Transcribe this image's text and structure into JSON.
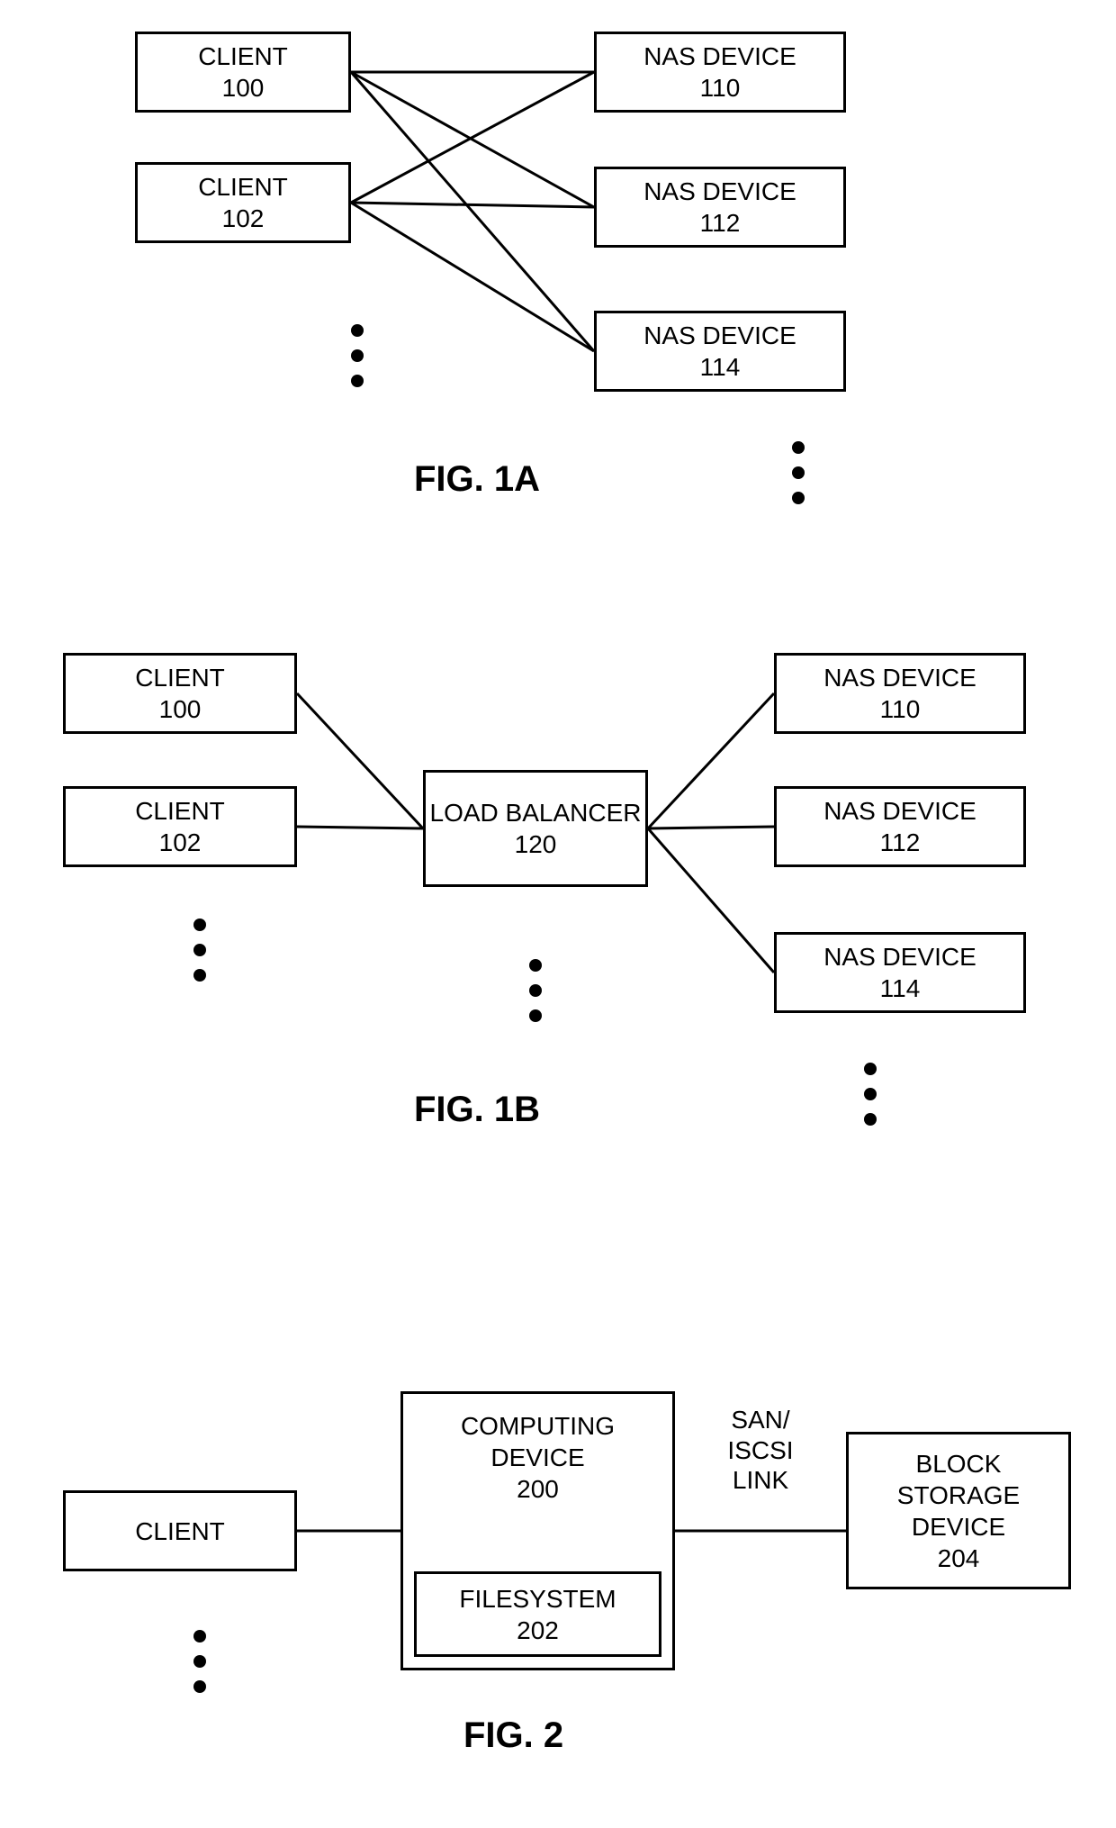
{
  "fig1a": {
    "clients": [
      {
        "name": "CLIENT",
        "id": "100"
      },
      {
        "name": "CLIENT",
        "id": "102"
      }
    ],
    "nas": [
      {
        "name": "NAS DEVICE",
        "id": "110"
      },
      {
        "name": "NAS DEVICE",
        "id": "112"
      },
      {
        "name": "NAS DEVICE",
        "id": "114"
      }
    ],
    "label": "FIG. 1A"
  },
  "fig1b": {
    "clients": [
      {
        "name": "CLIENT",
        "id": "100"
      },
      {
        "name": "CLIENT",
        "id": "102"
      }
    ],
    "balancer": {
      "name": "LOAD BALANCER",
      "id": "120"
    },
    "nas": [
      {
        "name": "NAS DEVICE",
        "id": "110"
      },
      {
        "name": "NAS DEVICE",
        "id": "112"
      },
      {
        "name": "NAS DEVICE",
        "id": "114"
      }
    ],
    "label": "FIG. 1B"
  },
  "fig2": {
    "client": {
      "name": "CLIENT"
    },
    "compute": {
      "name": "COMPUTING DEVICE",
      "id": "200"
    },
    "filesystem": {
      "name": "FILESYSTEM",
      "id": "202"
    },
    "link_label_top": "SAN/",
    "link_label_mid": "ISCSI",
    "link_label_bot": "LINK",
    "storage": {
      "name": "BLOCK STORAGE DEVICE",
      "id": "204"
    },
    "label": "FIG. 2"
  }
}
